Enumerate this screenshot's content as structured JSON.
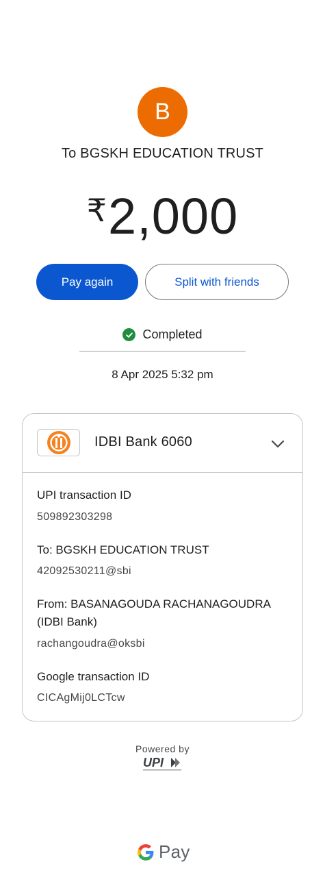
{
  "payee": {
    "initial": "B",
    "avatar_color": "#ed6c02",
    "title": "To BGSKH EDUCATION TRUST"
  },
  "amount": {
    "currency": "₹",
    "value": "2,000"
  },
  "actions": {
    "pay_again_label": "Pay again",
    "split_label": "Split with friends"
  },
  "status": {
    "icon": "check-circle-icon",
    "label": "Completed",
    "color": "#1e8e3e"
  },
  "datetime": "8 Apr 2025 5:32 pm",
  "details": {
    "bank": {
      "logo_icon": "idbi-bank-logo",
      "label": "IDBI Bank 6060",
      "expand_icon": "chevron-down-icon"
    },
    "rows": [
      {
        "label": "UPI transaction ID",
        "value": "509892303298"
      },
      {
        "label": "To: BGSKH EDUCATION TRUST",
        "value": "42092530211@sbi"
      },
      {
        "label": "From: BASANAGOUDA RACHANAGOUDRA (IDBI Bank)",
        "value": "rachangoudra@oksbi"
      },
      {
        "label": "Google transaction ID",
        "value": "CICAgMij0LCTcw"
      }
    ]
  },
  "footer": {
    "powered_by": "Powered by",
    "upi_logo": "upi-logo",
    "brand_pay": "Pay"
  },
  "colors": {
    "primary": "#0b57d0",
    "success": "#1e8e3e",
    "avatar": "#ed6c02"
  }
}
